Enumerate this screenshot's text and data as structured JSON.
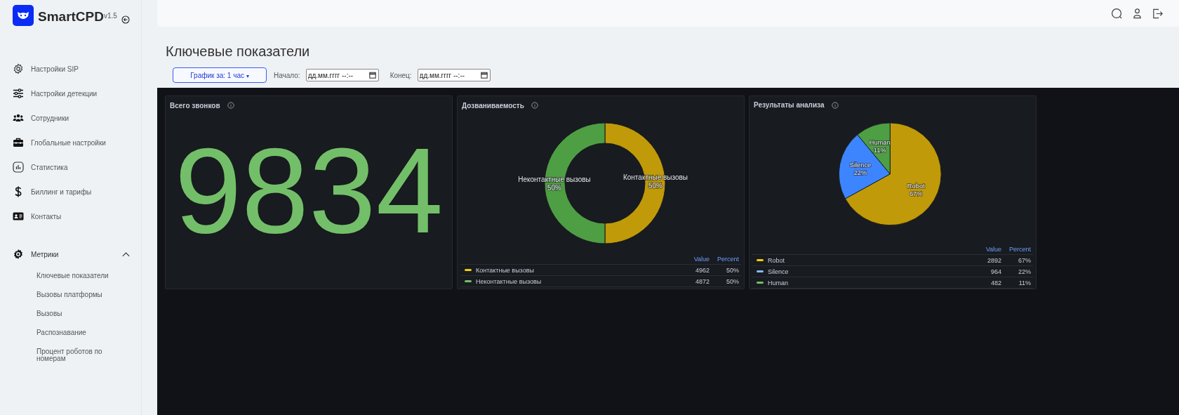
{
  "brand": {
    "name": "SmartCPD",
    "version": "v1.5"
  },
  "sidebar": {
    "items": [
      {
        "label": "Настройки SIP"
      },
      {
        "label": "Настройки детекции"
      },
      {
        "label": "Сотрудники"
      },
      {
        "label": "Глобальные настройки"
      },
      {
        "label": "Статистика"
      },
      {
        "label": "Биллинг и тарифы"
      },
      {
        "label": "Контакты"
      }
    ],
    "group": {
      "label": "Метрики",
      "expanded": true,
      "children": [
        {
          "label": "Ключевые показатели"
        },
        {
          "label": "Вызовы платформы"
        },
        {
          "label": "Вызовы"
        },
        {
          "label": "Распознавание"
        },
        {
          "label": "Процент роботов по номерам"
        }
      ]
    }
  },
  "page_title": "Ключевые показатели",
  "filters": {
    "period_button": "График за: 1 час",
    "period_caret": "▾",
    "start_label": "Начало:",
    "start_placeholder": "дд.мм.гггг --:--",
    "end_label": "Конец:",
    "end_placeholder": "дд.мм.гггг --:--"
  },
  "stat_panel": {
    "title": "Всего звонков",
    "value": "9834"
  },
  "charts": [
    {
      "title": "Дозваниваемость",
      "chart_data": {
        "type": "donut",
        "categories": [
          "Контактные вызовы",
          "Неконтактные вызовы"
        ],
        "series": [
          {
            "name": "Percent",
            "values": [
              50,
              50
            ]
          }
        ],
        "colors": [
          "#c09a08",
          "#4e9e44"
        ],
        "value_labels": [
          "50%",
          "50%"
        ]
      },
      "legend": {
        "value_column": "Value",
        "rows": [
          {
            "name": "Контактные вызовы",
            "value": "4962",
            "percent": "50%",
            "color": "#f2cc0c"
          },
          {
            "name": "Неконтактные вызовы",
            "value": "4872",
            "percent": "50%",
            "color": "#73bf69"
          }
        ]
      }
    },
    {
      "title": "Результаты анализа",
      "chart_data": {
        "type": "pie",
        "categories": [
          "Robot",
          "Silence",
          "Human"
        ],
        "series": [
          {
            "name": "Percent",
            "values": [
              67,
              22,
              11
            ]
          }
        ],
        "colors": [
          "#c09a08",
          "#3d85ff",
          "#4e9e44"
        ],
        "value_labels": [
          "67%",
          "22%",
          "11%"
        ]
      },
      "legend": {
        "value_column": "Value",
        "rows": [
          {
            "name": "Robot",
            "value": "2892",
            "percent": "67%",
            "color": "#f2cc0c"
          },
          {
            "name": "Silence",
            "value": "964",
            "percent": "22%",
            "color": "#8ab8ff"
          },
          {
            "name": "Human",
            "value": "482",
            "percent": "11%",
            "color": "#73bf69"
          }
        ]
      }
    }
  ]
}
